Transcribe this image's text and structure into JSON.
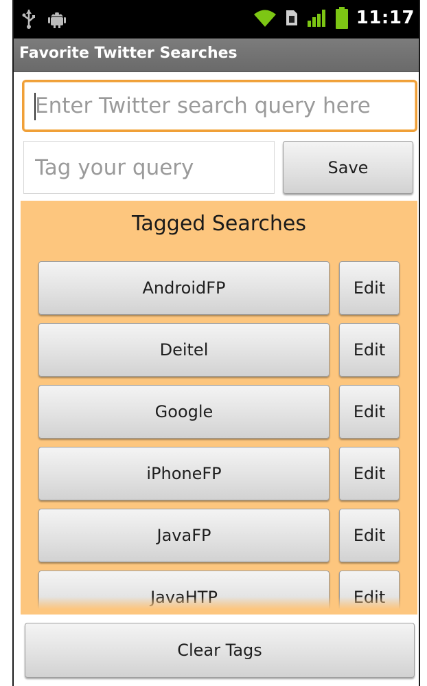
{
  "status_bar": {
    "time": "11:17",
    "left_icons": [
      "usb-icon",
      "android-debug-icon"
    ],
    "right_icons": [
      "wifi-icon",
      "sim-icon",
      "signal-icon",
      "battery-icon"
    ],
    "accent_color": "#7dc614"
  },
  "app": {
    "title": "Favorite Twitter Searches"
  },
  "query": {
    "placeholder": "Enter Twitter search query here",
    "value": ""
  },
  "tag": {
    "placeholder": "Tag your query",
    "value": ""
  },
  "save": {
    "label": "Save"
  },
  "tagged": {
    "title": "Tagged Searches",
    "panel_color": "#fdc67e",
    "items": [
      {
        "tag": "AndroidFP",
        "edit": "Edit"
      },
      {
        "tag": "Deitel",
        "edit": "Edit"
      },
      {
        "tag": "Google",
        "edit": "Edit"
      },
      {
        "tag": "iPhoneFP",
        "edit": "Edit"
      },
      {
        "tag": "JavaFP",
        "edit": "Edit"
      },
      {
        "tag": "JavaHTP",
        "edit": "Edit"
      }
    ]
  },
  "clear": {
    "label": "Clear Tags"
  }
}
